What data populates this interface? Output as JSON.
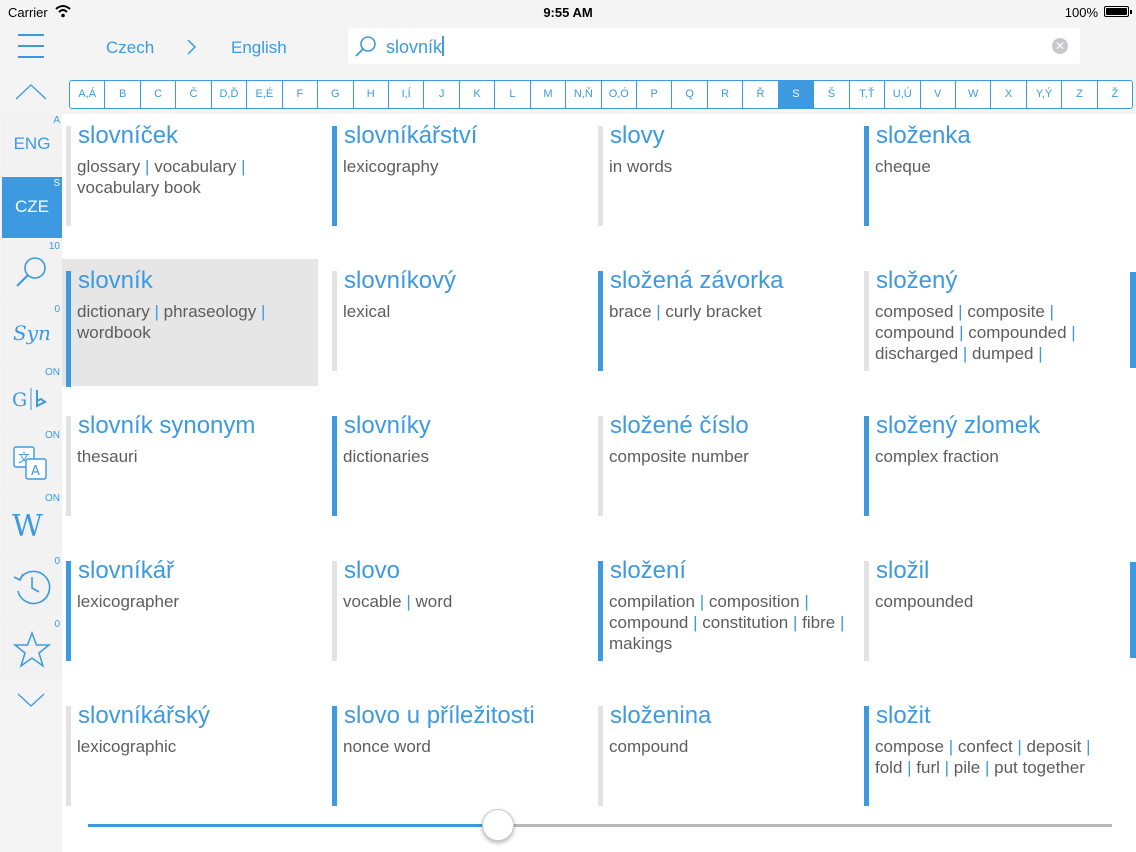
{
  "status_bar": {
    "carrier": "Carrier",
    "time": "9:55 AM",
    "battery": "100%"
  },
  "header": {
    "from_language": "Czech",
    "to_language": "English",
    "search_value": "slovník"
  },
  "alphabet": {
    "letters": [
      "A,Á",
      "B",
      "C",
      "Č",
      "D,Ď",
      "E,É",
      "F",
      "G",
      "H",
      "I,Í",
      "J",
      "K",
      "L",
      "M",
      "N,Ň",
      "O,Ó",
      "P",
      "Q",
      "R",
      "Ř",
      "S",
      "Š",
      "T,Ť",
      "U,Ú",
      "V",
      "W",
      "X",
      "Y,Ý",
      "Z",
      "Ž"
    ],
    "active": "S"
  },
  "sidebar": {
    "items": [
      {
        "label": "ENG",
        "badge": "A",
        "icon": null,
        "active": false
      },
      {
        "label": "CZE",
        "badge": "S",
        "icon": null,
        "active": true
      },
      {
        "label": "",
        "badge": "10",
        "icon": "search-icon",
        "active": false
      },
      {
        "label": "Syn",
        "badge": "0",
        "icon": null,
        "active": false
      },
      {
        "label": "",
        "badge": "ON",
        "icon": "google-bing-icon",
        "active": false
      },
      {
        "label": "",
        "badge": "ON",
        "icon": "translate-icon",
        "active": false
      },
      {
        "label": "",
        "badge": "ON",
        "icon": "wikipedia-icon",
        "active": false
      },
      {
        "label": "",
        "badge": "0",
        "icon": "history-icon",
        "active": false
      },
      {
        "label": "",
        "badge": "0",
        "icon": "star-icon",
        "active": false
      }
    ]
  },
  "entries": [
    {
      "head": "slovníček",
      "translations": [
        "glossary",
        "vocabulary",
        "vocabulary book"
      ],
      "bar": "grey"
    },
    {
      "head": "slovníkářství",
      "translations": [
        "lexicography"
      ],
      "bar": "blue"
    },
    {
      "head": "slovy",
      "translations": [
        "in words"
      ],
      "bar": "grey"
    },
    {
      "head": "složenka",
      "translations": [
        "cheque"
      ],
      "bar": "blue"
    },
    {
      "head": "slovník",
      "translations": [
        "dictionary",
        "phraseology",
        "wordbook"
      ],
      "bar": "blue",
      "selected": true
    },
    {
      "head": "slovníkový",
      "translations": [
        "lexical"
      ],
      "bar": "grey"
    },
    {
      "head": "složená závorka",
      "translations": [
        "brace",
        "curly bracket"
      ],
      "bar": "blue"
    },
    {
      "head": "složený",
      "translations": [
        "composed",
        "composite",
        "compound",
        "compounded",
        "discharged",
        "dumped"
      ],
      "bar": "grey"
    },
    {
      "head": "slovník synonym",
      "translations": [
        "thesauri"
      ],
      "bar": "grey"
    },
    {
      "head": "slovníky",
      "translations": [
        "dictionaries"
      ],
      "bar": "blue"
    },
    {
      "head": "složené číslo",
      "translations": [
        "composite number"
      ],
      "bar": "grey"
    },
    {
      "head": "složený zlomek",
      "translations": [
        "complex fraction"
      ],
      "bar": "blue"
    },
    {
      "head": "slovníkář",
      "translations": [
        "lexicographer"
      ],
      "bar": "blue"
    },
    {
      "head": "slovo",
      "translations": [
        "vocable",
        "word"
      ],
      "bar": "grey"
    },
    {
      "head": "složení",
      "translations": [
        "compilation",
        "composition",
        "compound",
        "constitution",
        "fibre",
        "makings"
      ],
      "bar": "blue"
    },
    {
      "head": "složil",
      "translations": [
        "compounded"
      ],
      "bar": "grey"
    },
    {
      "head": "slovníkářský",
      "translations": [
        "lexicographic"
      ],
      "bar": "grey"
    },
    {
      "head": "slovo u příležitosti",
      "translations": [
        "nonce word"
      ],
      "bar": "blue"
    },
    {
      "head": "složenina",
      "translations": [
        "compound"
      ],
      "bar": "grey"
    },
    {
      "head": "složit",
      "translations": [
        "compose",
        "confect",
        "deposit",
        "fold",
        "furl",
        "pile",
        "put together"
      ],
      "bar": "blue"
    }
  ],
  "slider": {
    "value": 0.4
  },
  "colors": {
    "accent": "#3d9ae0",
    "selected_bg": "#e6e6e6",
    "chrome_bg": "#f4f4f4"
  }
}
